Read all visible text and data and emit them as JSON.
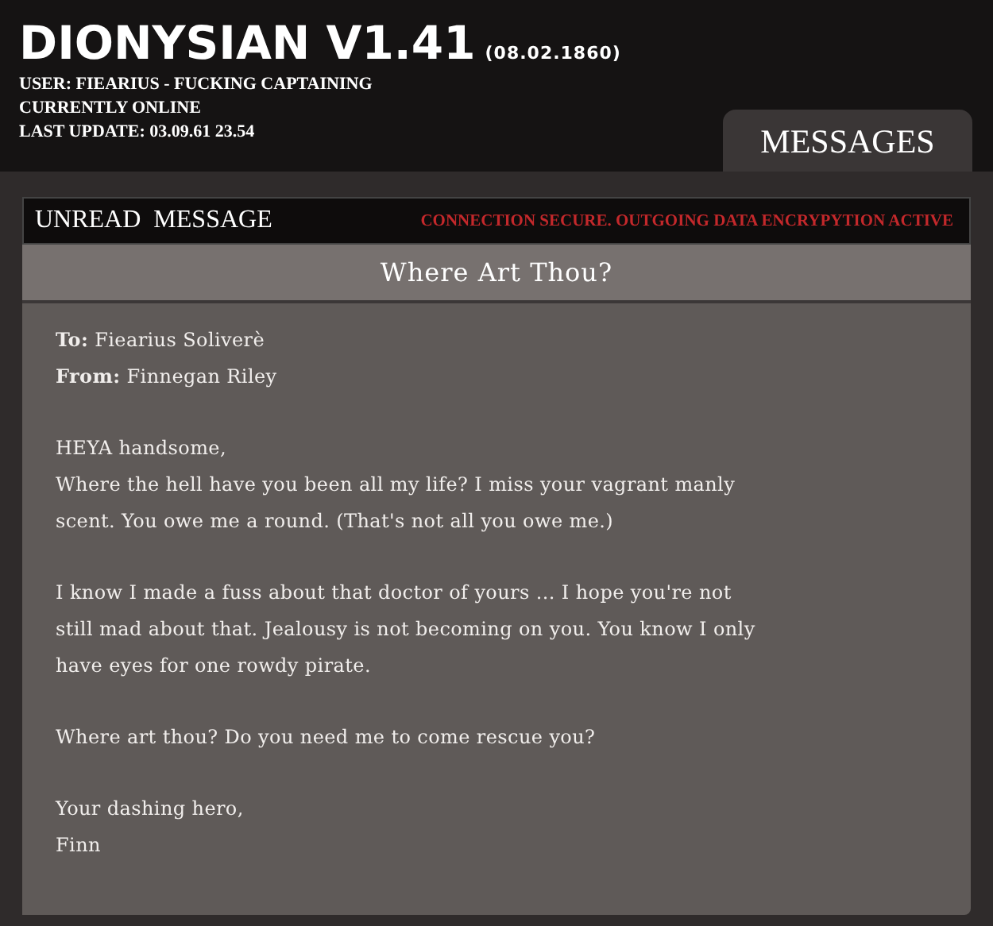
{
  "header": {
    "title": "DIONYSIAN V1.41",
    "date": "(08.02.1860)",
    "info_lines": [
      "USER: FIEARIUS - FUCKING CAPTAINING",
      "CURRENTLY ONLINE",
      "LAST UPDATE: 03.09.61 23.54"
    ]
  },
  "tabs": [
    {
      "label": "MESSAGES",
      "selected": true
    }
  ],
  "message_bar": {
    "label": "UNREAD  MESSAGE",
    "status": "CONNECTION SECURE. OUTGOING DATA ENCRYPYTION ACTIVE"
  },
  "message": {
    "subject": "Where Art Thou?",
    "fields": [
      "**To:** Fiearius Soliverè",
      "**From:** Finnegan Riley"
    ],
    "paragraphs": [
      [
        "HEYA handsome,",
        "Where the hell have you been all my life? I miss your vagrant manly",
        "scent. You owe me a round. (That's not all you owe me.)"
      ],
      [
        "I know I made a fuss about that doctor of yours ...  I hope you're not",
        "still mad about that. Jealousy is not becoming on you. You know I only",
        "have eyes for one rowdy pirate."
      ],
      [
        "Where art thou? Do you need me to come rescue you?"
      ],
      [
        "Your dashing hero,",
        "Finn"
      ]
    ]
  }
}
